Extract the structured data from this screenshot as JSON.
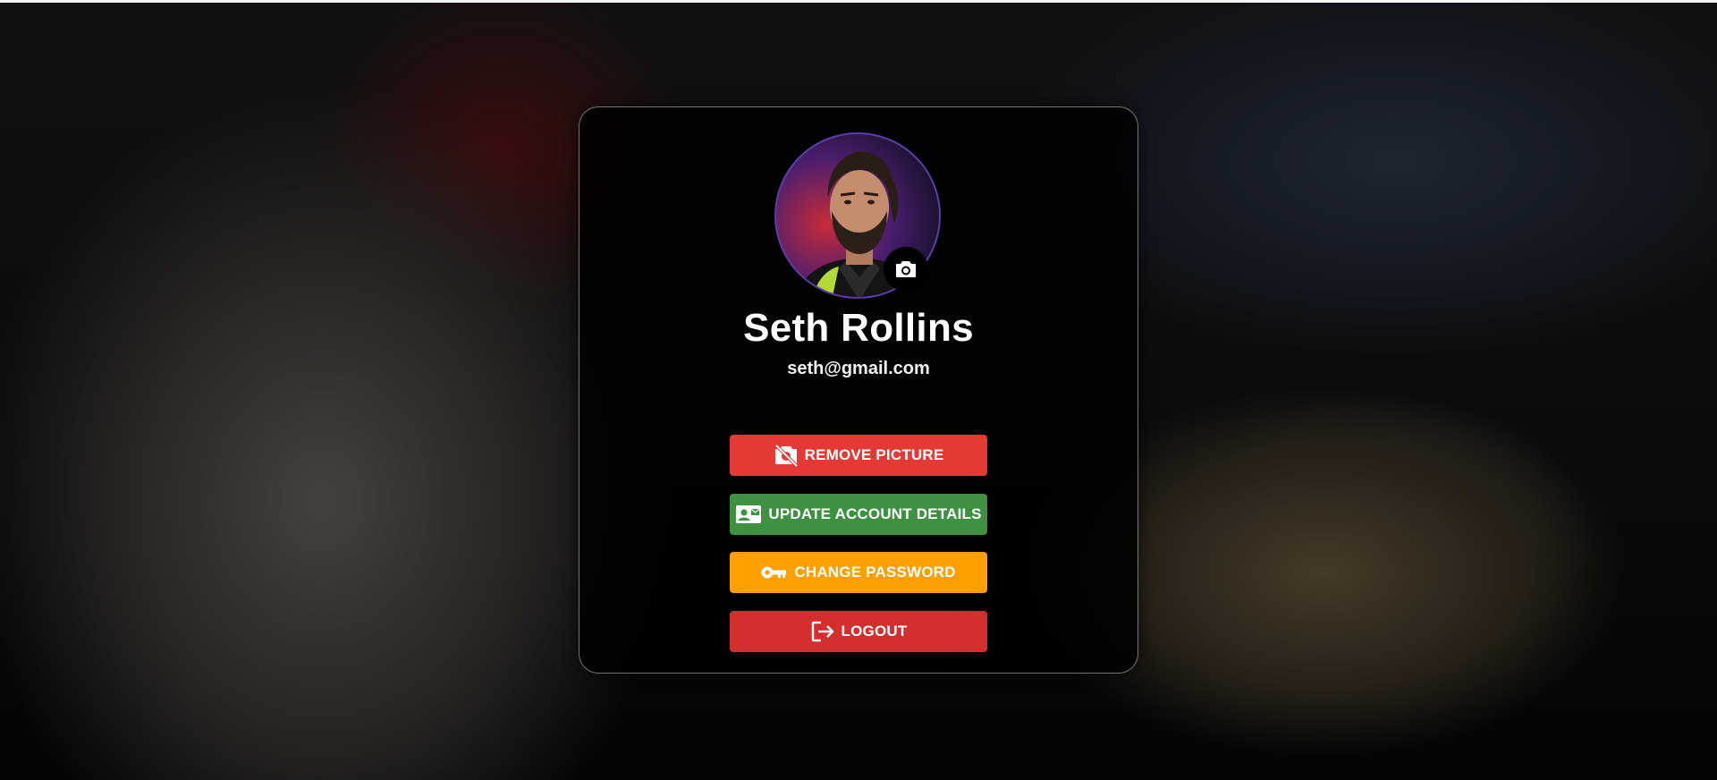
{
  "profile": {
    "name": "Seth Rollins",
    "email": "seth@gmail.com"
  },
  "actions": {
    "remove_picture": "REMOVE PICTURE",
    "update_account": "UPDATE ACCOUNT DETAILS",
    "change_password": "CHANGE PASSWORD",
    "logout": "LOGOUT"
  },
  "icons": {
    "camera": "camera-icon",
    "remove": "no-photography-icon",
    "update": "contact-mail-icon",
    "password": "key-icon",
    "logout": "logout-icon"
  },
  "colors": {
    "remove": "#e53935",
    "update": "#3f9142",
    "password": "#ff9f00",
    "logout": "#d32f2f"
  }
}
